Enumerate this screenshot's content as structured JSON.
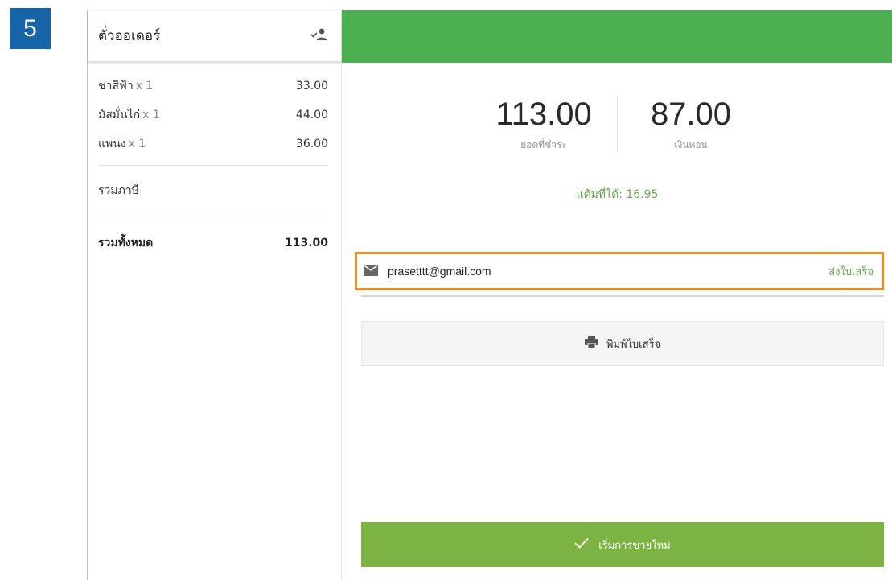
{
  "step_number": "5",
  "order_panel": {
    "title": "ตั๋วออเดอร์",
    "icon": "user-check-icon",
    "items": [
      {
        "name": "ชาสีฟ้า",
        "qty": "x 1",
        "price": "33.00"
      },
      {
        "name": "มัสมั่นไก่",
        "qty": "x 1",
        "price": "44.00"
      },
      {
        "name": "แพนง",
        "qty": "x 1",
        "price": "36.00"
      }
    ],
    "tax_label": "รวมภาษี",
    "total_label": "รวมทั้งหมด",
    "total_value": "113.00"
  },
  "payment": {
    "header_color": "#4caf50",
    "amount_due": "113.00",
    "amount_due_label": "ยอดที่ชำระ",
    "change": "87.00",
    "change_label": "เงินทอน",
    "points_text": "แต้มที่ได้: 16.95"
  },
  "receipt": {
    "email_icon": "mail-icon",
    "email_value": "prasetttt@gmail.com",
    "send_label": "ส่งใบเสร็จ",
    "print_icon": "printer-icon",
    "print_label": "พิมพ์ใบเสร็จ",
    "new_sale_icon": "check-icon",
    "new_sale_label": "เริ่มการขายใหม่"
  },
  "colors": {
    "step_badge": "#1565a8",
    "accent_green": "#6aa84f",
    "new_sale_green": "#7cb342",
    "highlight_orange": "#f08a24"
  }
}
